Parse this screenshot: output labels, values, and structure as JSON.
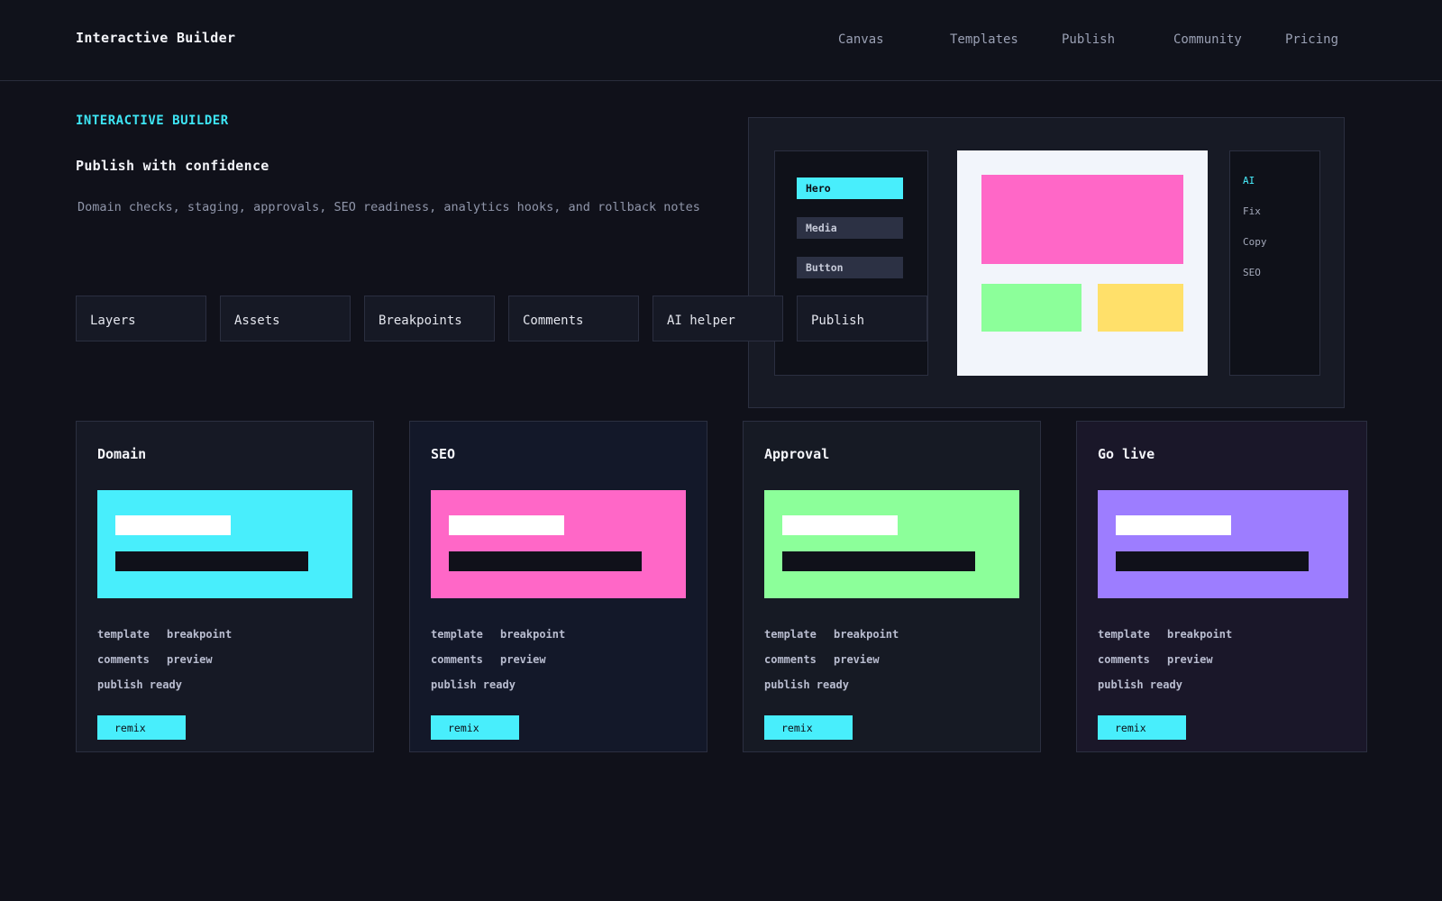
{
  "header": {
    "brand": "Interactive Builder",
    "nav": [
      "Canvas",
      "Templates",
      "Publish",
      "Community",
      "Pricing"
    ]
  },
  "hero": {
    "eyebrow": "INTERACTIVE BUILDER",
    "title": "Publish with confidence",
    "description": "Domain checks, staging, approvals, SEO readiness, analytics hooks, and rollback notes"
  },
  "tools": [
    "Layers",
    "Assets",
    "Breakpoints",
    "Comments",
    "AI helper",
    "Publish"
  ],
  "editor": {
    "blocks": [
      "Hero",
      "Media",
      "Button"
    ],
    "assist": [
      "AI",
      "Fix",
      "Copy",
      "SEO"
    ]
  },
  "cards": [
    {
      "title": "Domain",
      "color": "#48eefc",
      "bg": "#161925"
    },
    {
      "title": "SEO",
      "color": "#ff67c7",
      "bg": "#131829"
    },
    {
      "title": "Approval",
      "color": "#8cff9a",
      "bg": "#161a24"
    },
    {
      "title": "Go live",
      "color": "#9d7dff",
      "bg": "#1a1729"
    }
  ],
  "card_tags": {
    "template": "template",
    "breakpoint": "breakpoint",
    "comments": "comments",
    "preview": "preview",
    "publish_ready": "publish ready"
  },
  "card_action": "remix",
  "colors": {
    "accent": "#48eefc",
    "background": "#10111a",
    "canvas_hero": "#ff67c7",
    "canvas_green": "#8cff9a",
    "canvas_yellow": "#ffe06a"
  }
}
